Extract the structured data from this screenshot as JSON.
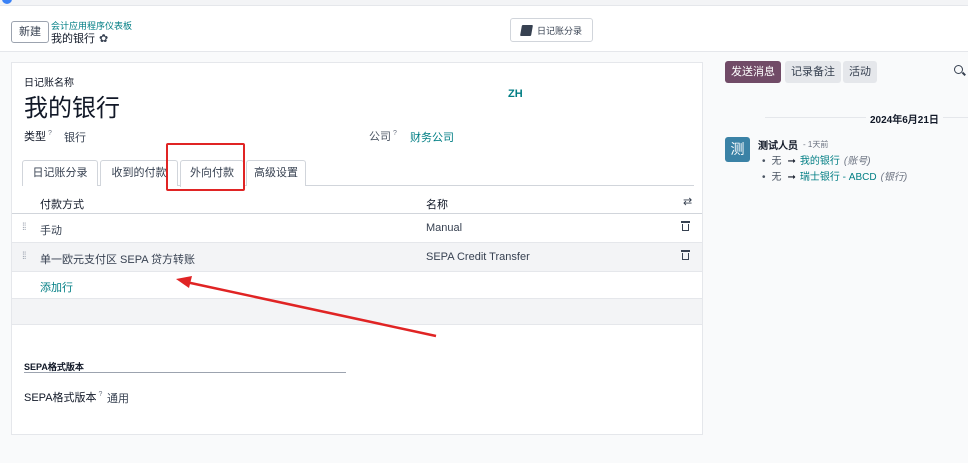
{
  "control_panel": {
    "new_button": "新建",
    "breadcrumb_parent": "会计应用程序仪表板",
    "breadcrumb_current": "我的银行",
    "journal_entries_button": "日记账分录"
  },
  "form": {
    "journal_name_label": "日记账名称",
    "journal_name": "我的银行",
    "lang_code": "ZH",
    "type_label": "类型",
    "type_value": "银行",
    "company_label": "公司",
    "company_value": "财务公司",
    "tooltip_mark": "?",
    "tabs": [
      {
        "label": "日记账分录",
        "active": false
      },
      {
        "label": "收到的付款",
        "active": false
      },
      {
        "label": "外向付款",
        "active": true
      },
      {
        "label": "高级设置",
        "active": false
      }
    ],
    "table": {
      "headers": [
        "付款方式",
        "名称"
      ],
      "rows": [
        {
          "method": "手动",
          "name": "Manual"
        },
        {
          "method": "单一欧元支付区 SEPA 贷方转账",
          "name": "SEPA Credit Transfer"
        }
      ],
      "add_line": "添加行"
    },
    "sepa_section_title": "SEPA格式版本",
    "sepa_version_label": "SEPA格式版本",
    "sepa_version_value": "通用"
  },
  "chatter": {
    "send_message": "发送消息",
    "log_note": "记录备注",
    "activities": "活动",
    "date_separator": "2024年6月21日",
    "message": {
      "avatar_text": "测",
      "author": "测试人员",
      "time": "- 1天前",
      "changes": [
        {
          "old": "无",
          "new": "我的银行",
          "field": "(账号)"
        },
        {
          "old": "无",
          "new": "瑞士银行 - ABCD",
          "field": "(银行)"
        }
      ]
    }
  },
  "colors": {
    "accent": "#017e84",
    "primary_button": "#714b67",
    "annotation_red": "#e02424"
  }
}
